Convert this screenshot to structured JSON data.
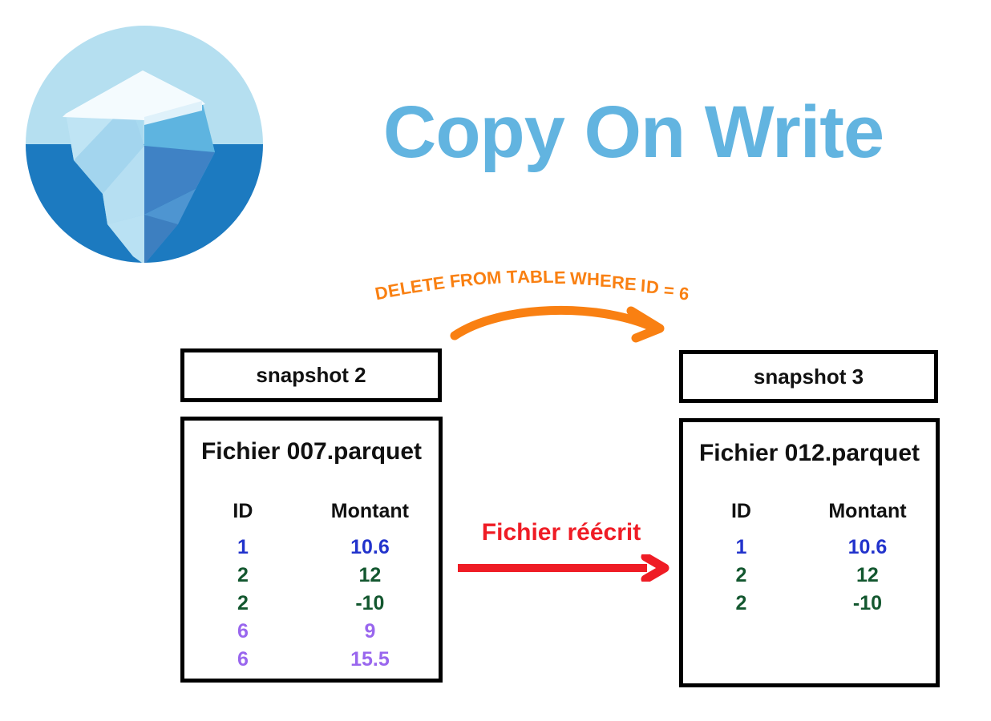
{
  "page": {
    "title": "Copy On Write",
    "background": "#ffffff",
    "title_color": "#62b4e0"
  },
  "logo": {
    "name": "apache-iceberg-logo",
    "water_light": "#b5dff0",
    "water_dark": "#1c7ac0",
    "ice_light": "#eef8fd",
    "ice_mid": "#a8d9ef",
    "ice_blue": "#5bbde4",
    "ice_shadow": "#4e8fc8"
  },
  "sql_annotation": {
    "text": "DELETE FROM TABLE WHERE ID = 6",
    "color": "#f98012"
  },
  "orange_arrow": {
    "name": "curved-arrow-delete",
    "color": "#f98012"
  },
  "rewrite": {
    "label": "Fichier réécrit",
    "color": "#ef1c25",
    "arrow_name": "straight-arrow-rewrite"
  },
  "left": {
    "snapshot_label": "snapshot 2",
    "file_title": "Fichier 007.parquet",
    "columns": [
      "ID",
      "Montant"
    ],
    "rows": [
      {
        "id": "1",
        "montant": "10.6",
        "color": "#2233cc"
      },
      {
        "id": "2",
        "montant": "12",
        "color": "#13572f"
      },
      {
        "id": "2",
        "montant": "-10",
        "color": "#13572f"
      },
      {
        "id": "6",
        "montant": "9",
        "color": "#9966ee"
      },
      {
        "id": "6",
        "montant": "15.5",
        "color": "#9966ee"
      }
    ]
  },
  "right": {
    "snapshot_label": "snapshot 3",
    "file_title": "Fichier 012.parquet",
    "columns": [
      "ID",
      "Montant"
    ],
    "rows": [
      {
        "id": "1",
        "montant": "10.6",
        "color": "#2233cc"
      },
      {
        "id": "2",
        "montant": "12",
        "color": "#13572f"
      },
      {
        "id": "2",
        "montant": "-10",
        "color": "#13572f"
      }
    ]
  },
  "colors": {
    "blue_row": "#2233cc",
    "green_row": "#13572f",
    "purple_row": "#9966ee",
    "box_border": "#000000"
  }
}
